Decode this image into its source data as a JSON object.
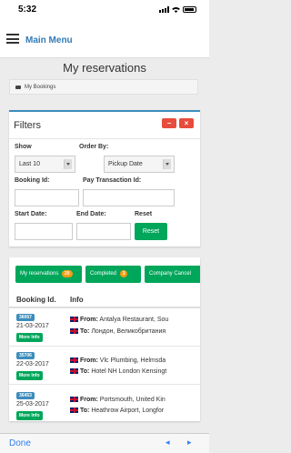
{
  "status": {
    "time": "5:32"
  },
  "header": {
    "menu_label": "Main Menu"
  },
  "page": {
    "title": "My reservations",
    "breadcrumb": "My Bookings"
  },
  "filters": {
    "title": "Filters",
    "collapse_symbol": "−",
    "close_symbol": "×",
    "show_label": "Show",
    "show_value": "Last 10",
    "order_label": "Order By:",
    "order_value": "Pickup Date",
    "booking_label": "Booking Id:",
    "pay_label": "Pay Transaction Id:",
    "start_label": "Start Date:",
    "end_label": "End Date:",
    "reset_label": "Reset",
    "reset_button": "Reset"
  },
  "tabs": [
    {
      "label": "My reservations",
      "count": "20"
    },
    {
      "label": "Completed",
      "count": "3"
    },
    {
      "label": "Company Cancel"
    }
  ],
  "table": {
    "headers": [
      "Booking Id.",
      "Info"
    ],
    "more_info_label": "More Info",
    "from_label": "From:",
    "to_label": "To:",
    "rows": [
      {
        "id": "36067",
        "date": "21-03-2017",
        "from": "Antalya Restaurant, Sou",
        "to": "Лондон, Великобритания"
      },
      {
        "id": "35706",
        "date": "22-03-2017",
        "from": "Vlc Plumbing, Helmsda",
        "to": "Hotel NH London Kensingt"
      },
      {
        "id": "36453",
        "date": "25-03-2017",
        "from": "Portsmouth, United Kin",
        "to": "Heathrow Airport, Longfor"
      }
    ]
  },
  "bottom": {
    "done_label": "Done",
    "prev_symbol": "◂",
    "next_symbol": "▸"
  },
  "colors": {
    "accent": "#337ab7",
    "success": "#00a65a",
    "danger": "#e74c3c",
    "badge": "#f39c12",
    "id_badge": "#3c8dbc"
  }
}
